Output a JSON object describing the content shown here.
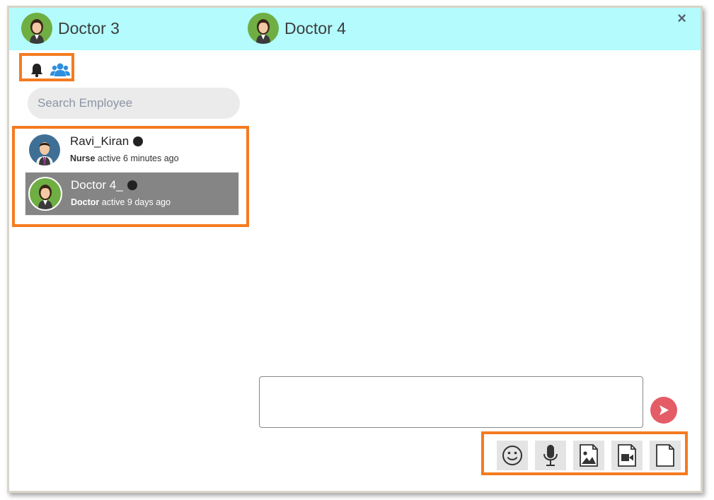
{
  "header": {
    "current_user": "Doctor 3",
    "chat_partner": "Doctor 4",
    "close_label": "×"
  },
  "sidebar": {
    "icons": [
      "bell-icon",
      "group-icon"
    ],
    "search": {
      "placeholder": "Search Employee",
      "value": ""
    },
    "employees": [
      {
        "name": "Ravi_Kiran",
        "role": "Nurse",
        "status": "active 6 minutes ago",
        "selected": false
      },
      {
        "name": "Doctor 4_",
        "role": "Doctor",
        "status": "active 9 days ago",
        "selected": true
      }
    ]
  },
  "composer": {
    "value": "",
    "send_icon": "send-icon",
    "tools": [
      "emoji-icon",
      "microphone-icon",
      "image-icon",
      "video-icon",
      "file-icon"
    ]
  },
  "colors": {
    "header_bg": "#b3fbfd",
    "highlight": "#f47b20",
    "selected_row": "#858585",
    "send_button": "#e45c66",
    "avatar_bg": "#6fae43",
    "avatar_nurse_bg": "#3f6f95"
  }
}
